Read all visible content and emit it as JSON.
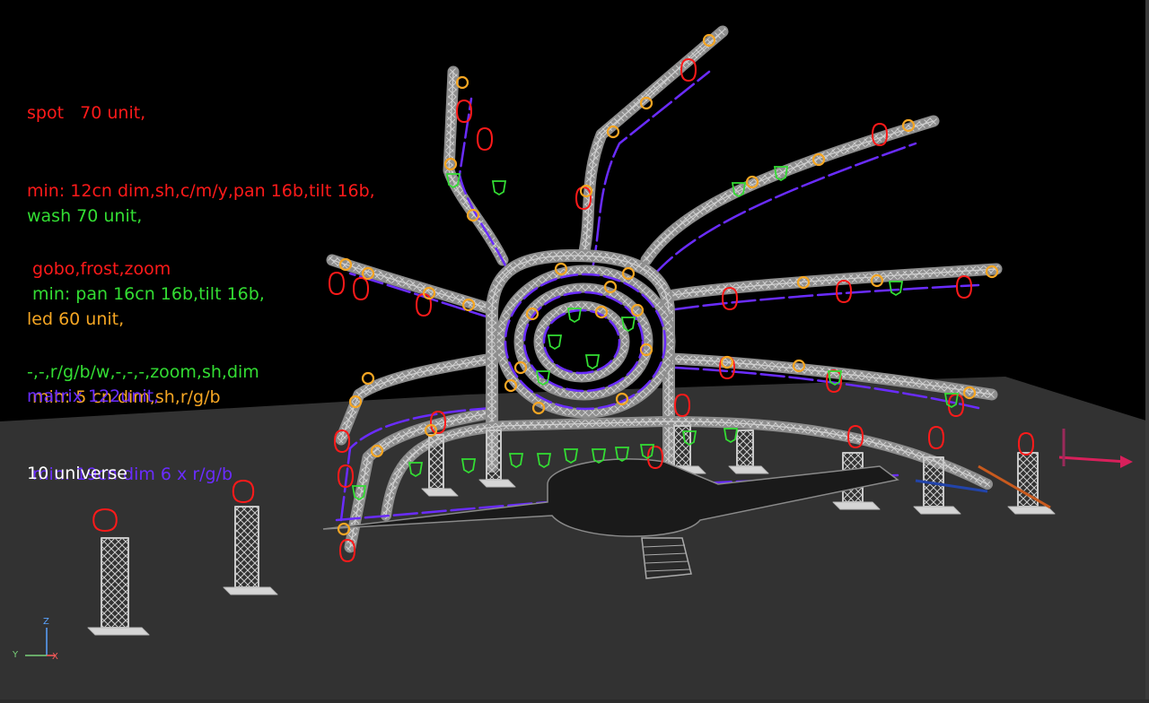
{
  "colors": {
    "background": "#000000",
    "floor": "#323232",
    "truss": "#b4b4b4",
    "spot": "#ff1a1a",
    "wash": "#33dd33",
    "led": "#f5a623",
    "matrix": "#6a2cff",
    "universe": "#ffffff"
  },
  "legend": {
    "spot": [
      "spot   70 unit,",
      "min: 12cn dim,sh,c/m/y,pan 16b,tilt 16b,",
      " gobo,frost,zoom"
    ],
    "wash": [
      "wash 70 unit,",
      " min: pan 16cn 16b,tilt 16b,",
      "-,-,r/g/b/w,-,-,-,zoom,sh,dim"
    ],
    "led": [
      "led 60 unit,",
      " min: 5 cn dim,sh,r/g/b"
    ],
    "matrix": [
      "matrix 122unit,",
      " min: 19cn dim 6 x r/g/b"
    ],
    "universe": "10 universe"
  },
  "axes": {
    "z": "Z",
    "y": "Y",
    "x": "X"
  },
  "icons": {
    "gizmo": "axis-gizmo-icon",
    "view-gizmo": "view-orientation-icon"
  }
}
